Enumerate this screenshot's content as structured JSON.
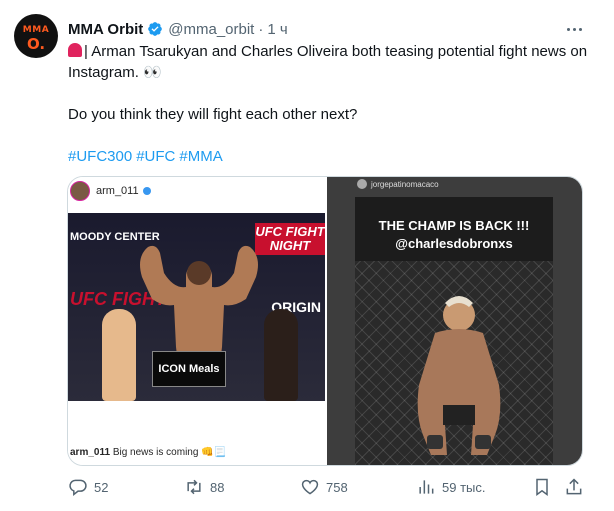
{
  "tweet": {
    "display_name": "MMA Orbit",
    "handle": "@mma_orbit",
    "separator": "·",
    "time": "1 ч",
    "avatar_line1": "MMA",
    "avatar_line2": "O.",
    "text_line1_prefix": "| Arman Tsarukyan and Charles Oliveira both teasing potential fight news on Instagram.",
    "text_eyes": "👀",
    "text_line2": "Do you think they will fight each other next?",
    "hashtags": [
      "#UFC300",
      "#UFC",
      "#MMA"
    ]
  },
  "media": {
    "left": {
      "username": "arm_011",
      "banner_moody": "MOODY CENTER",
      "banner_ufc": "UFC FIGHT NIGHT",
      "banner_ufc2": "UFC FIGHT",
      "banner_origin": "ORIGIN",
      "sponsor": "ICON Meals",
      "caption_user": "arm_011",
      "caption_text": "Big news is coming 👊📃"
    },
    "right": {
      "username": "jorgepatinomacaco",
      "headline": "THE CHAMP IS BACK !!!",
      "mention": "@charlesdobronxs"
    }
  },
  "actions": {
    "replies": "52",
    "reposts": "88",
    "likes": "758",
    "views": "59 тыс."
  },
  "colors": {
    "accent": "#1d9bf0",
    "text": "#0f1419",
    "muted": "#536471",
    "border": "#cfd9de"
  }
}
